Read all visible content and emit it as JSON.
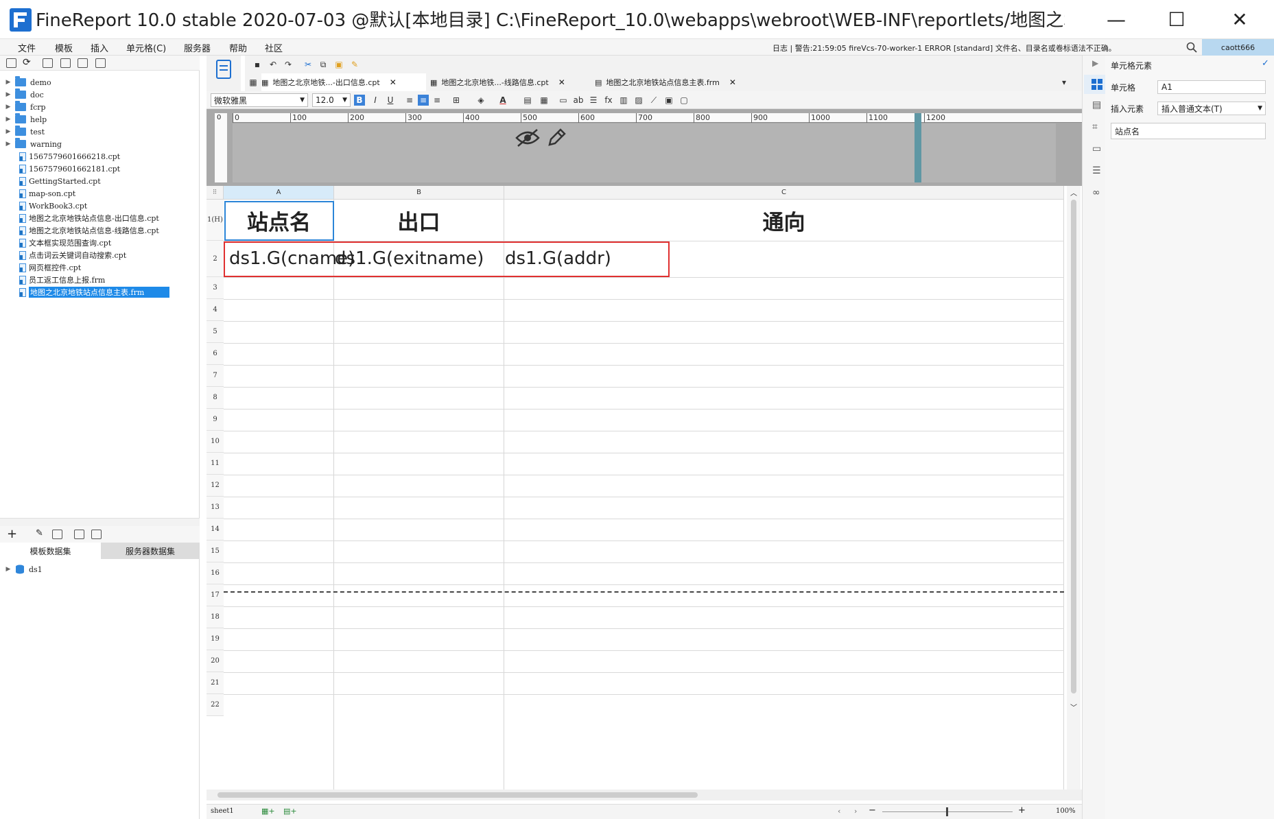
{
  "window": {
    "title": "FineReport 10.0 stable 2020-07-03 @默认[本地目录]    C:\\FineReport_10.0\\webapps\\webroot\\WEB-INF\\reportlets/地图之北京地铁站...",
    "minimize": "—",
    "maximize": "☐",
    "close": "✕"
  },
  "menu": {
    "items": [
      "文件",
      "模板",
      "插入",
      "单元格(C)",
      "服务器",
      "帮助",
      "社区"
    ],
    "status": "日志 | 警告:21:59:05 fireVcs-70-worker-1 ERROR [standard] 文件名、目录名或卷标语法不正确。",
    "user": "caott666"
  },
  "tree": {
    "folders": [
      "demo",
      "doc",
      "fcrp",
      "help",
      "test",
      "warning"
    ],
    "files": [
      "1567579601666218.cpt",
      "1567579601662181.cpt",
      "GettingStarted.cpt",
      "map-son.cpt",
      "WorkBook3.cpt",
      "地图之北京地铁站点信息-出口信息.cpt",
      "地图之北京地铁站点信息-线路信息.cpt",
      "文本框实现范围查询.cpt",
      "点击词云关键词自动搜索.cpt",
      "网页框控件.cpt",
      "员工返工信息上报.frm",
      "地图之北京地铁站点信息主表.frm"
    ],
    "selected_index": 11
  },
  "dataset": {
    "tab_template": "模板数据集",
    "tab_server": "服务器数据集",
    "items": [
      "ds1"
    ]
  },
  "file_tabs": [
    {
      "label": "地图之北京地铁...-出口信息.cpt"
    },
    {
      "label": "地图之北京地铁...-线路信息.cpt"
    },
    {
      "label": "地图之北京地铁站点信息主表.frm"
    }
  ],
  "format": {
    "font": "微软雅黑",
    "size": "12.0"
  },
  "ruler": {
    "ticks": [
      "0",
      "100",
      "200",
      "300",
      "400",
      "500",
      "600",
      "700",
      "800",
      "900",
      "1000",
      "1100",
      "1200"
    ]
  },
  "sheet": {
    "columns": [
      "A",
      "B",
      "C"
    ],
    "row_labels": [
      "1(H)",
      "2",
      "3",
      "4",
      "5",
      "6",
      "7",
      "8",
      "9",
      "10",
      "11",
      "12",
      "13",
      "14",
      "15",
      "16",
      "17",
      "18",
      "19",
      "20",
      "21",
      "22"
    ],
    "header_cells": [
      "站点名",
      "出口",
      "通向"
    ],
    "data_cells": [
      "ds1.G(cname)",
      "ds1.G(exitname)",
      "ds1.G(addr)"
    ]
  },
  "status_bar": {
    "sheet_name": "sheet1",
    "zoom": "100%"
  },
  "right_panel": {
    "title": "单元格元素",
    "cell_label": "单元格",
    "cell_value": "A1",
    "insert_label": "插入元素",
    "insert_value": "插入普通文本(T)",
    "content_value": "站点名"
  },
  "colors": {
    "selection_blue": "#2b85d8",
    "highlight_red": "#e03030",
    "tree_selection": "#1e8ae8",
    "accent": "#1e8ae8"
  }
}
